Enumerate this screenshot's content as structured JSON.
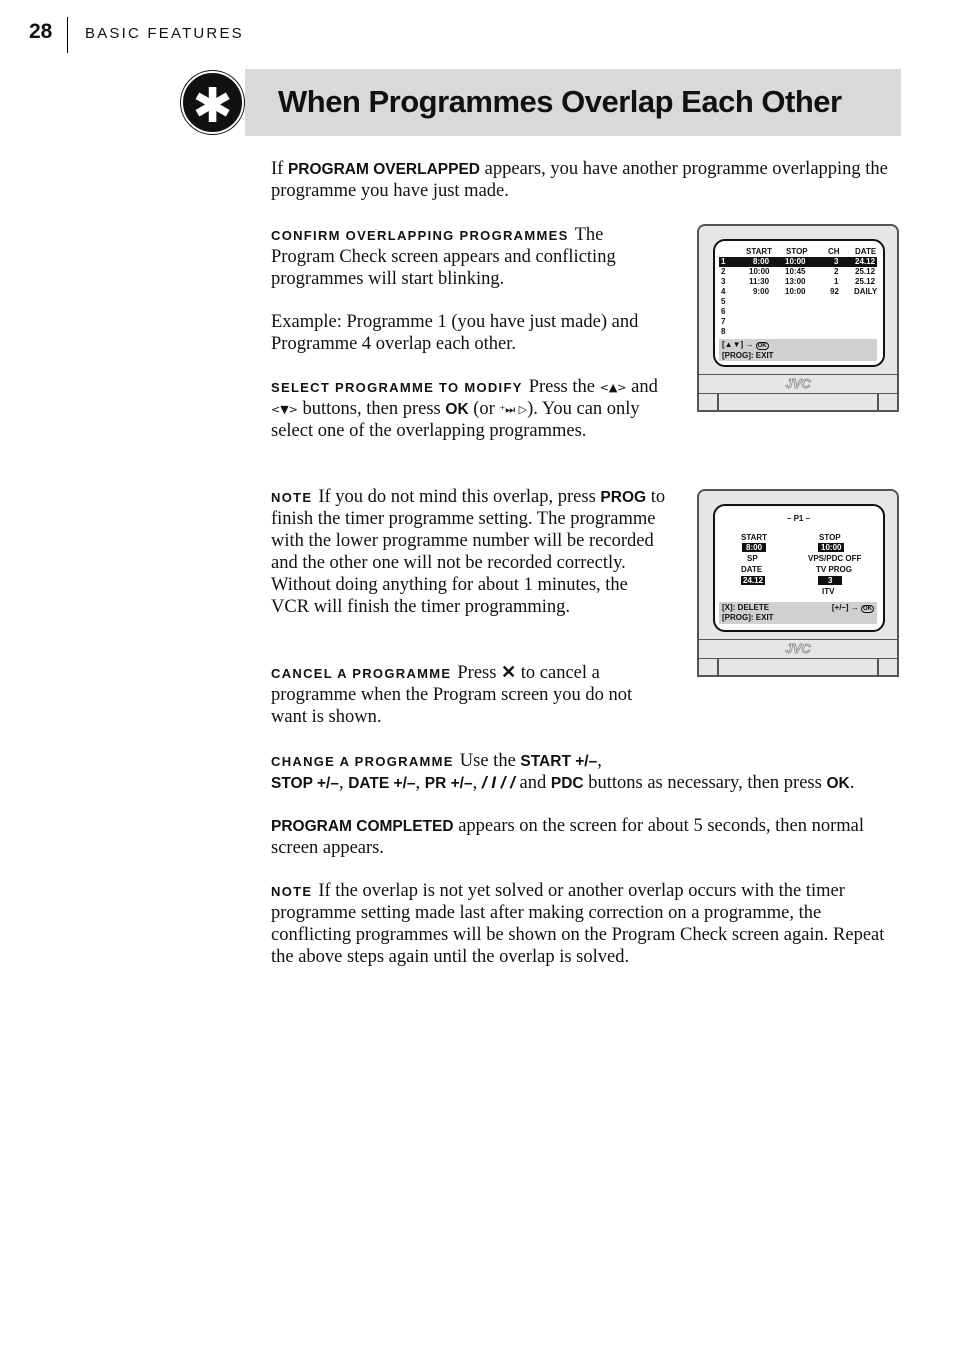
{
  "header": {
    "page_number": "28",
    "section": "BASIC FEATURES"
  },
  "title": "When Programmes Overlap Each Other",
  "title_icon": "asterisk-icon",
  "intro": {
    "a": "If ",
    "b": "PROGRAM OVERLAPPED",
    "c": " appears, you have another programme overlapping the programme you have just made."
  },
  "confirm": {
    "heading": "CONFIRM OVERLAPPING PROGRAMMES",
    "text": "The Program Check screen appears and conflicting programmes will start blinking."
  },
  "example": "Example: Programme 1 (you have just made) and Programme 4 overlap each other.",
  "select": {
    "heading": "SELECT PROGRAMME TO MODIFY",
    "a": "Press the",
    "b": "and",
    "c": "buttons, then press",
    "ok": "OK",
    "d": "(or",
    "e": "). You can only select one of the overlapping programmes."
  },
  "note1": {
    "heading": "NOTE",
    "a": "If you do not mind this overlap, press",
    "prog": "PROG",
    "b": "to finish the timer programme setting. The programme with the lower programme number will be recorded and the other one will not be recorded correctly. Without doing anything for about 1 minutes, the VCR will finish the timer programming."
  },
  "cancel": {
    "heading": "CANCEL A PROGRAMME",
    "a": "Press",
    "b": "to cancel a programme when the Program screen you do not want is shown."
  },
  "change": {
    "heading": "CHANGE A PROGRAMME",
    "a": "Use the",
    "start": "START +/–",
    "c1": ",",
    "stop": "STOP +/–",
    "c2": ", ",
    "date": "DATE +/–",
    "c3": ", ",
    "pr": "PR +/–",
    "c4": ", ",
    "d": "and",
    "pdc": "PDC",
    "e": "buttons as necessary, then press",
    "ok": "OK",
    "f": "."
  },
  "completed": {
    "b": "PROGRAM COMPLETED",
    "a": "appears on the screen for about 5 seconds, then normal screen appears."
  },
  "note2": {
    "heading": "NOTE",
    "text": "If the overlap is not yet solved or another overlap occurs with the timer programme setting made last after making correction on a programme, the conflicting programmes will be shown on the Program Check screen again. Repeat the above steps again until the overlap is solved."
  },
  "tv1": {
    "brand": "JVC",
    "headers": [
      "START",
      "STOP",
      "CH",
      "DATE"
    ],
    "rows": [
      [
        "1",
        "8:00",
        "10:00",
        "3",
        "24.12"
      ],
      [
        "2",
        "10:00",
        "10:45",
        "2",
        "25.12"
      ],
      [
        "3",
        "11:30",
        "13:00",
        "1",
        "25.12"
      ],
      [
        "4",
        "9:00",
        "10:00",
        "92",
        "DAILY"
      ]
    ],
    "empty_rows": [
      "5",
      "6",
      "7",
      "8"
    ],
    "help1": "[▲▼] →",
    "ok": "OK",
    "help2": "[PROG]: EXIT"
  },
  "tv2": {
    "brand": "JVC",
    "title": "– P1 –",
    "start_label": "START",
    "start": "8:00",
    "stop_label": "STOP",
    "stop": "10:00",
    "speed": "SP",
    "vps": "VPS/PDC OFF",
    "date_label": "DATE",
    "date": "24.12",
    "tvprog_label": "TV PROG",
    "tvprog": "3",
    "station": "ITV",
    "delete": "[X]: DELETE",
    "adjust": "[+/–] →",
    "ok": "OK",
    "exit": "[PROG]: EXIT"
  }
}
